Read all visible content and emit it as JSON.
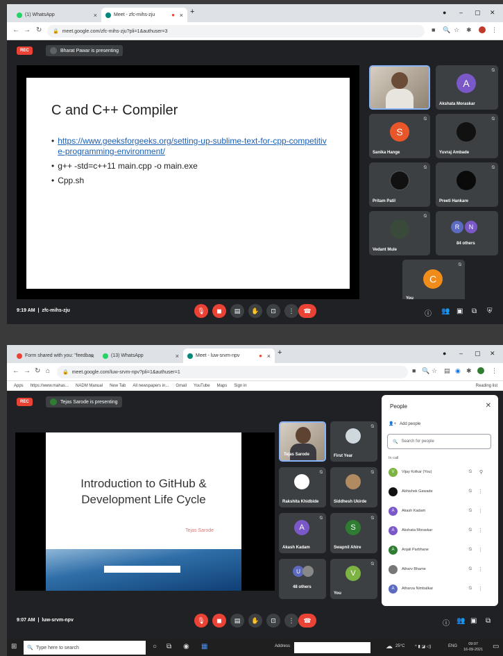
{
  "shot1": {
    "tabs": [
      {
        "label": "(1) WhatsApp",
        "icon": "whatsapp-icon",
        "color": "#25d366"
      },
      {
        "label": "Meet - zfc-mihs-zju",
        "icon": "meet-icon",
        "color": "#00897b"
      }
    ],
    "url": "meet.google.com/zfc-mihs-zju?pli=1&authuser=3",
    "rec_label": "REC",
    "presenting": "Bharat Pawar is presenting",
    "slide": {
      "title": "C and C++ Compiler",
      "bullets": [
        {
          "text": "https://www.geeksforgeeks.org/setting-up-sublime-text-for-cpp-competitive-programming-environment/",
          "link": true
        },
        {
          "text": "g++ -std=c++11 main.cpp -o main.exe",
          "link": false
        },
        {
          "text": "Cpp.sh",
          "link": false
        }
      ]
    },
    "participants": [
      {
        "name": "",
        "initial": "",
        "color": "#8a7a6a",
        "video": true
      },
      {
        "name": "Akshata Moraskar",
        "initial": "A",
        "color": "#7b58c8"
      },
      {
        "name": "Sanika Hange",
        "initial": "S",
        "color": "#e8562a"
      },
      {
        "name": "Yuvraj Ambade",
        "initial": "",
        "color": "#111111"
      },
      {
        "name": "Pritam Patil",
        "initial": "",
        "color": "#222222"
      },
      {
        "name": "Preeti Hankare",
        "initial": "",
        "color": "#0a0a0a"
      },
      {
        "name": "Vedant Mule",
        "initial": "",
        "color": "#3a4a3a"
      },
      {
        "name": "84 others",
        "initial": "R",
        "initial2": "N",
        "color": "#5c6bc0",
        "color2": "#7b58c8"
      },
      {
        "name": "You",
        "initial": "C",
        "color": "#f08c1a"
      }
    ],
    "meeting_time": "9:19 AM",
    "meeting_code": "zfc-mihs-zju"
  },
  "shot2": {
    "tabs": [
      {
        "label": "Form shared with you: \"feedbac",
        "icon": "gmail-icon",
        "color": "#ea4335"
      },
      {
        "label": "(13) WhatsApp",
        "icon": "whatsapp-icon",
        "color": "#25d366"
      },
      {
        "label": "Meet - luw-srvm-npv",
        "icon": "meet-icon",
        "color": "#00897b"
      }
    ],
    "url": "meet.google.com/luw-srvm-npv?pli=1&authuser=1",
    "bookmarks": [
      "Apps",
      "https://www.mahas...",
      "NADM Manual",
      "New Tab",
      "All newspapers in...",
      "Gmail",
      "YouTube",
      "Maps",
      "Sign in"
    ],
    "reading_list": "Reading list",
    "rec_label": "REC",
    "presenting": "Tejas Sarode is presenting",
    "slide": {
      "title_line1": "Introduction to GitHub &",
      "title_line2": "Development Life Cycle",
      "author": "Tejas Sarode"
    },
    "participants": [
      {
        "name": "Tejas Sarode",
        "initial": "",
        "color": "#7a6050",
        "video": true
      },
      {
        "name": "First Year",
        "initial": "",
        "color": "#cfd8dc"
      },
      {
        "name": "Rakshita Khidbide",
        "initial": "",
        "color": "#ffffff"
      },
      {
        "name": "Siddhesh Ukirde",
        "initial": "",
        "color": "#b08a60"
      },
      {
        "name": "Akash Kadam",
        "initial": "A",
        "color": "#7b58c8"
      },
      {
        "name": "Swapnil Ahire",
        "initial": "S",
        "color": "#2e7d32"
      },
      {
        "name": "48 others",
        "initial": "U",
        "color": "#5c6bc0"
      },
      {
        "name": "You",
        "initial": "V",
        "color": "#7cb342"
      }
    ],
    "people_panel": {
      "title": "People",
      "add_people": "Add people",
      "search_placeholder": "Search for people",
      "in_call": "In call",
      "list": [
        {
          "name": "Vijay Kolkar (You)",
          "initial": "V",
          "color": "#7cb342"
        },
        {
          "name": "Abhishek Gawade",
          "initial": "",
          "color": "#111111"
        },
        {
          "name": "Akash Kadam",
          "initial": "A",
          "color": "#7b58c8"
        },
        {
          "name": "Akshata Moraskar",
          "initial": "A",
          "color": "#7b58c8"
        },
        {
          "name": "Anjali Parbhane",
          "initial": "A",
          "color": "#2e7d32"
        },
        {
          "name": "Atharv Bhame",
          "initial": "",
          "color": "#777777"
        },
        {
          "name": "Atharva Nimbalkar",
          "initial": "A",
          "color": "#5c6bc0"
        }
      ]
    },
    "meeting_time": "9:07 AM",
    "meeting_code": "luw-srvm-npv",
    "taskbar": {
      "search_placeholder": "Type here to search",
      "address_label": "Address",
      "weather": "25°C",
      "lang": "ENG",
      "clock_time": "09:07",
      "clock_date": "16-09-2021"
    }
  }
}
